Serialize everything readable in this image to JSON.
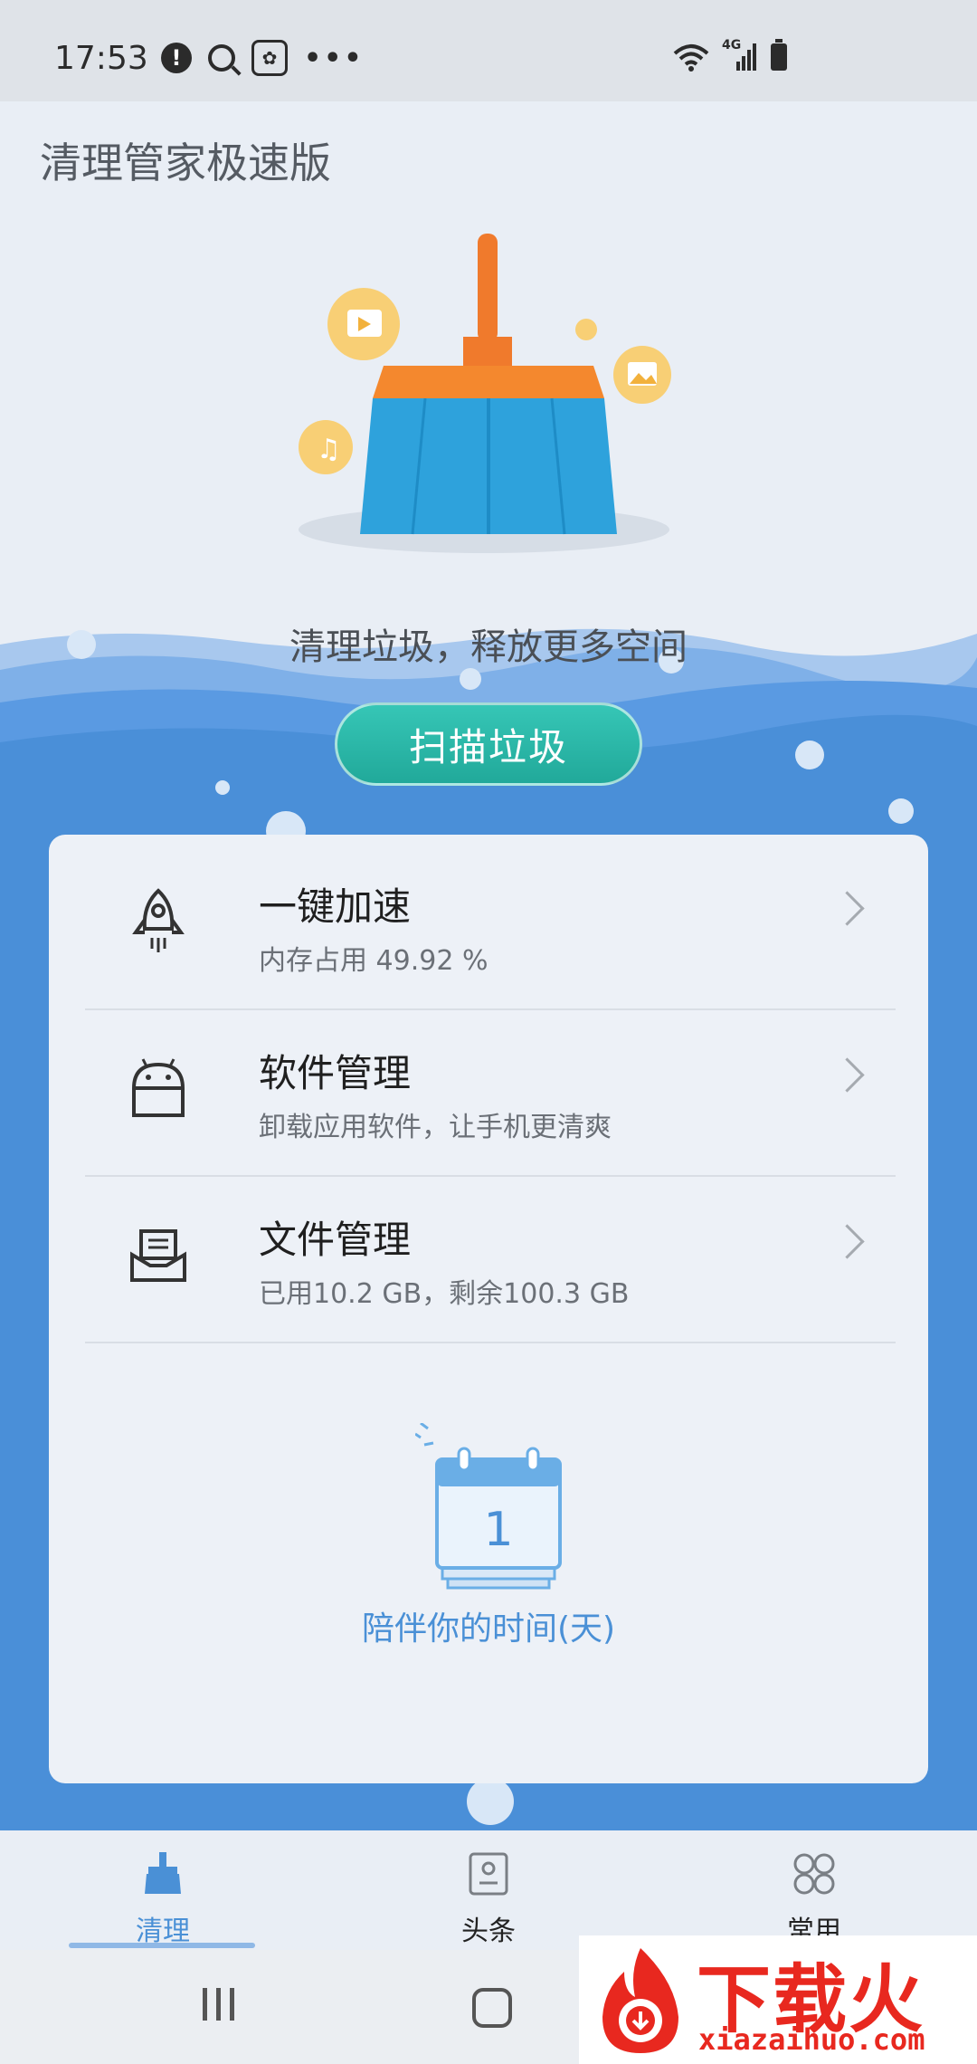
{
  "status": {
    "time": "17:53",
    "network": "4G"
  },
  "app": {
    "title": "清理管家极速版",
    "tagline": "清理垃圾，释放更多空间",
    "scan_button": "扫描垃圾"
  },
  "features": [
    {
      "title": "一键加速",
      "subtitle": "内存占用 49.92 %",
      "icon": "rocket-icon"
    },
    {
      "title": "软件管理",
      "subtitle": "卸载应用软件，让手机更清爽",
      "icon": "android-icon"
    },
    {
      "title": "文件管理",
      "subtitle": "已用10.2 GB，剩余100.3 GB",
      "icon": "folder-icon"
    }
  ],
  "companion": {
    "days": "1",
    "label": "陪伴你的时间(天)"
  },
  "tabs": [
    {
      "label": "清理",
      "active": true
    },
    {
      "label": "头条",
      "active": false
    },
    {
      "label": "常用",
      "active": false
    }
  ],
  "watermark": {
    "brand": "下载火",
    "url": "xiazaihuo.com"
  },
  "colors": {
    "accent": "#4a90d6",
    "scan_button": "#2bb5a6",
    "wave": "#4a8fd8",
    "watermark": "#e8281f"
  }
}
